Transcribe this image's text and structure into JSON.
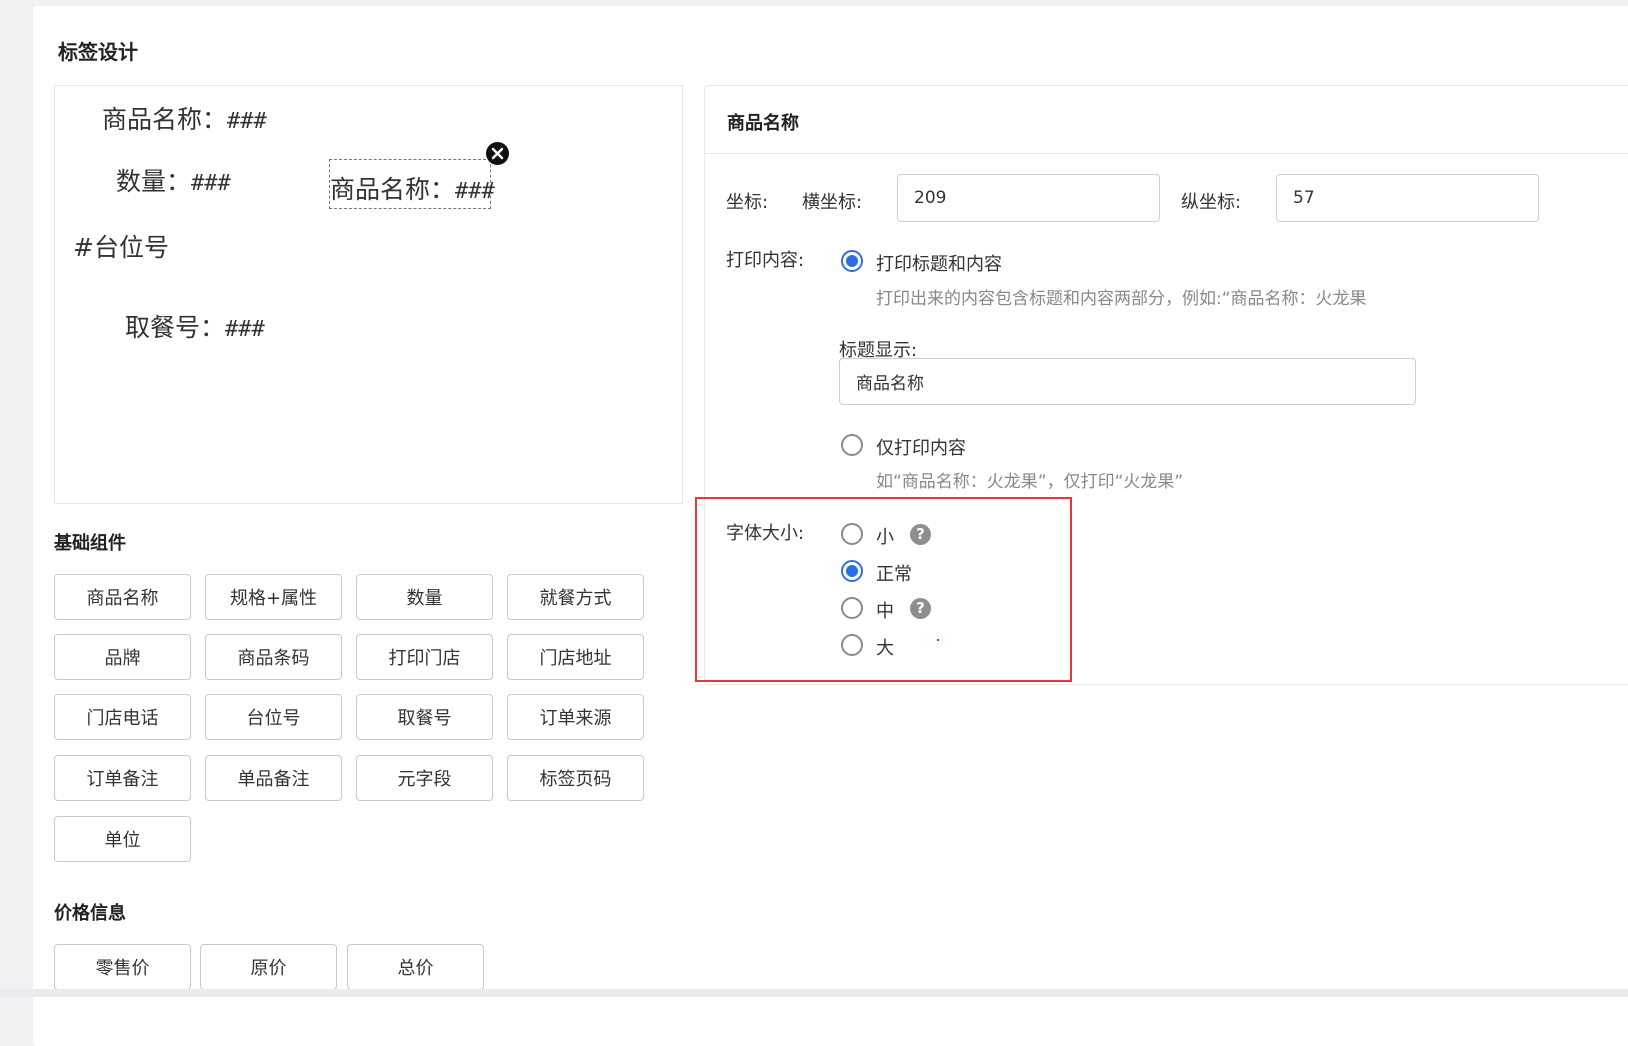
{
  "page_title": "标签设计",
  "canvas": {
    "labels": [
      {
        "title": "商品名称：",
        "value": "###"
      },
      {
        "title": "数量：",
        "value": "###"
      },
      {
        "title": "#台位号",
        "value": ""
      },
      {
        "title": "取餐号：",
        "value": "###"
      }
    ],
    "selected_label": {
      "title": "商品名称：",
      "value": "###"
    }
  },
  "basic_components": {
    "title": "基础组件",
    "items": [
      "商品名称",
      "规格+属性",
      "数量",
      "就餐方式",
      "品牌",
      "商品条码",
      "打印门店",
      "门店地址",
      "门店电话",
      "台位号",
      "取餐号",
      "订单来源",
      "订单备注",
      "单品备注",
      "元字段",
      "标签页码",
      "单位"
    ]
  },
  "price_info": {
    "title": "价格信息",
    "items": [
      "零售价",
      "原价",
      "总价"
    ]
  },
  "properties": {
    "header": "商品名称",
    "coord_label": "坐标:",
    "x_label": "横坐标:",
    "x_value": "209",
    "y_label": "纵坐标:",
    "y_value": "57",
    "print_content_label": "打印内容:",
    "option_title_content": "打印标题和内容",
    "option_title_content_hint": "打印出来的内容包含标题和内容两部分，例如:“商品名称：火龙果",
    "title_display_label": "标题显示:",
    "title_display_value": "商品名称",
    "option_content_only": "仅打印内容",
    "option_content_only_hint": "如“商品名称：火龙果”，仅打印“火龙果”",
    "print_mode_selected": "打印标题和内容",
    "font_size_label": "字体大小:",
    "font_sizes": [
      "小",
      "正常",
      "中",
      "大"
    ],
    "font_size_selected": "正常"
  },
  "colors": {
    "accent": "#2d6fe0",
    "highlight": "#e53935"
  }
}
